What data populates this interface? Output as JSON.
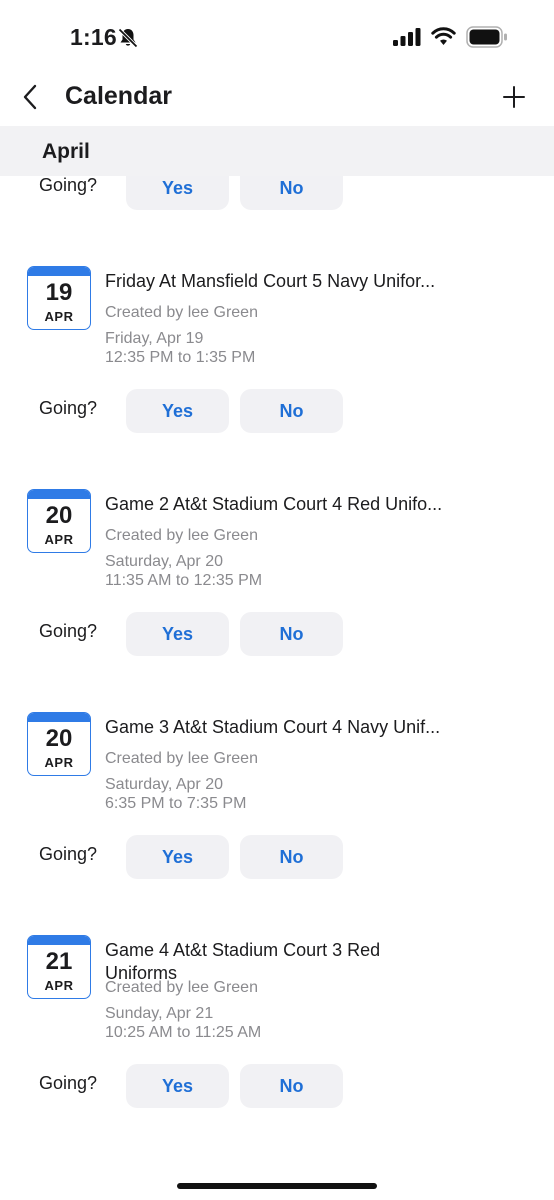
{
  "status_bar": {
    "time": "1:16"
  },
  "nav": {
    "title": "Calendar"
  },
  "section": {
    "title": "April"
  },
  "rsvp": {
    "going_label": "Going?",
    "yes_label": "Yes",
    "no_label": "No"
  },
  "events": [
    {
      "day": "19",
      "month": "APR",
      "title": "Friday At Mansfield Court 5 Navy Unifor...",
      "created_by": "Created by lee Green",
      "date": "Friday, Apr 19",
      "time": "12:35 PM to 1:35 PM"
    },
    {
      "day": "20",
      "month": "APR",
      "title": "Game 2 At&t Stadium Court 4 Red Unifo...",
      "created_by": "Created by lee Green",
      "date": "Saturday, Apr 20",
      "time": "11:35 AM to 12:35 PM"
    },
    {
      "day": "20",
      "month": "APR",
      "title": "Game 3 At&t Stadium Court 4 Navy Unif...",
      "created_by": "Created by lee Green",
      "date": "Saturday, Apr 20",
      "time": "6:35 PM to 7:35 PM"
    },
    {
      "day": "21",
      "month": "APR",
      "title": "Game 4 At&t Stadium Court 3 Red Uniforms",
      "created_by": "Created by lee Green",
      "date": "Sunday, Apr 21",
      "time": "10:25 AM to 11:25 AM"
    }
  ],
  "icons": {
    "bell": "bell-slash-icon",
    "signal": "cellular-signal-icon",
    "wifi": "wifi-icon",
    "battery": "battery-icon",
    "back": "chevron-left-icon",
    "add": "plus-icon"
  },
  "colors": {
    "accent": "#1f6fd6",
    "badge": "#2f7be6",
    "button_bg": "#f1f1f4",
    "section_bg": "#f2f2f4",
    "meta_text": "#8a8a8e"
  }
}
